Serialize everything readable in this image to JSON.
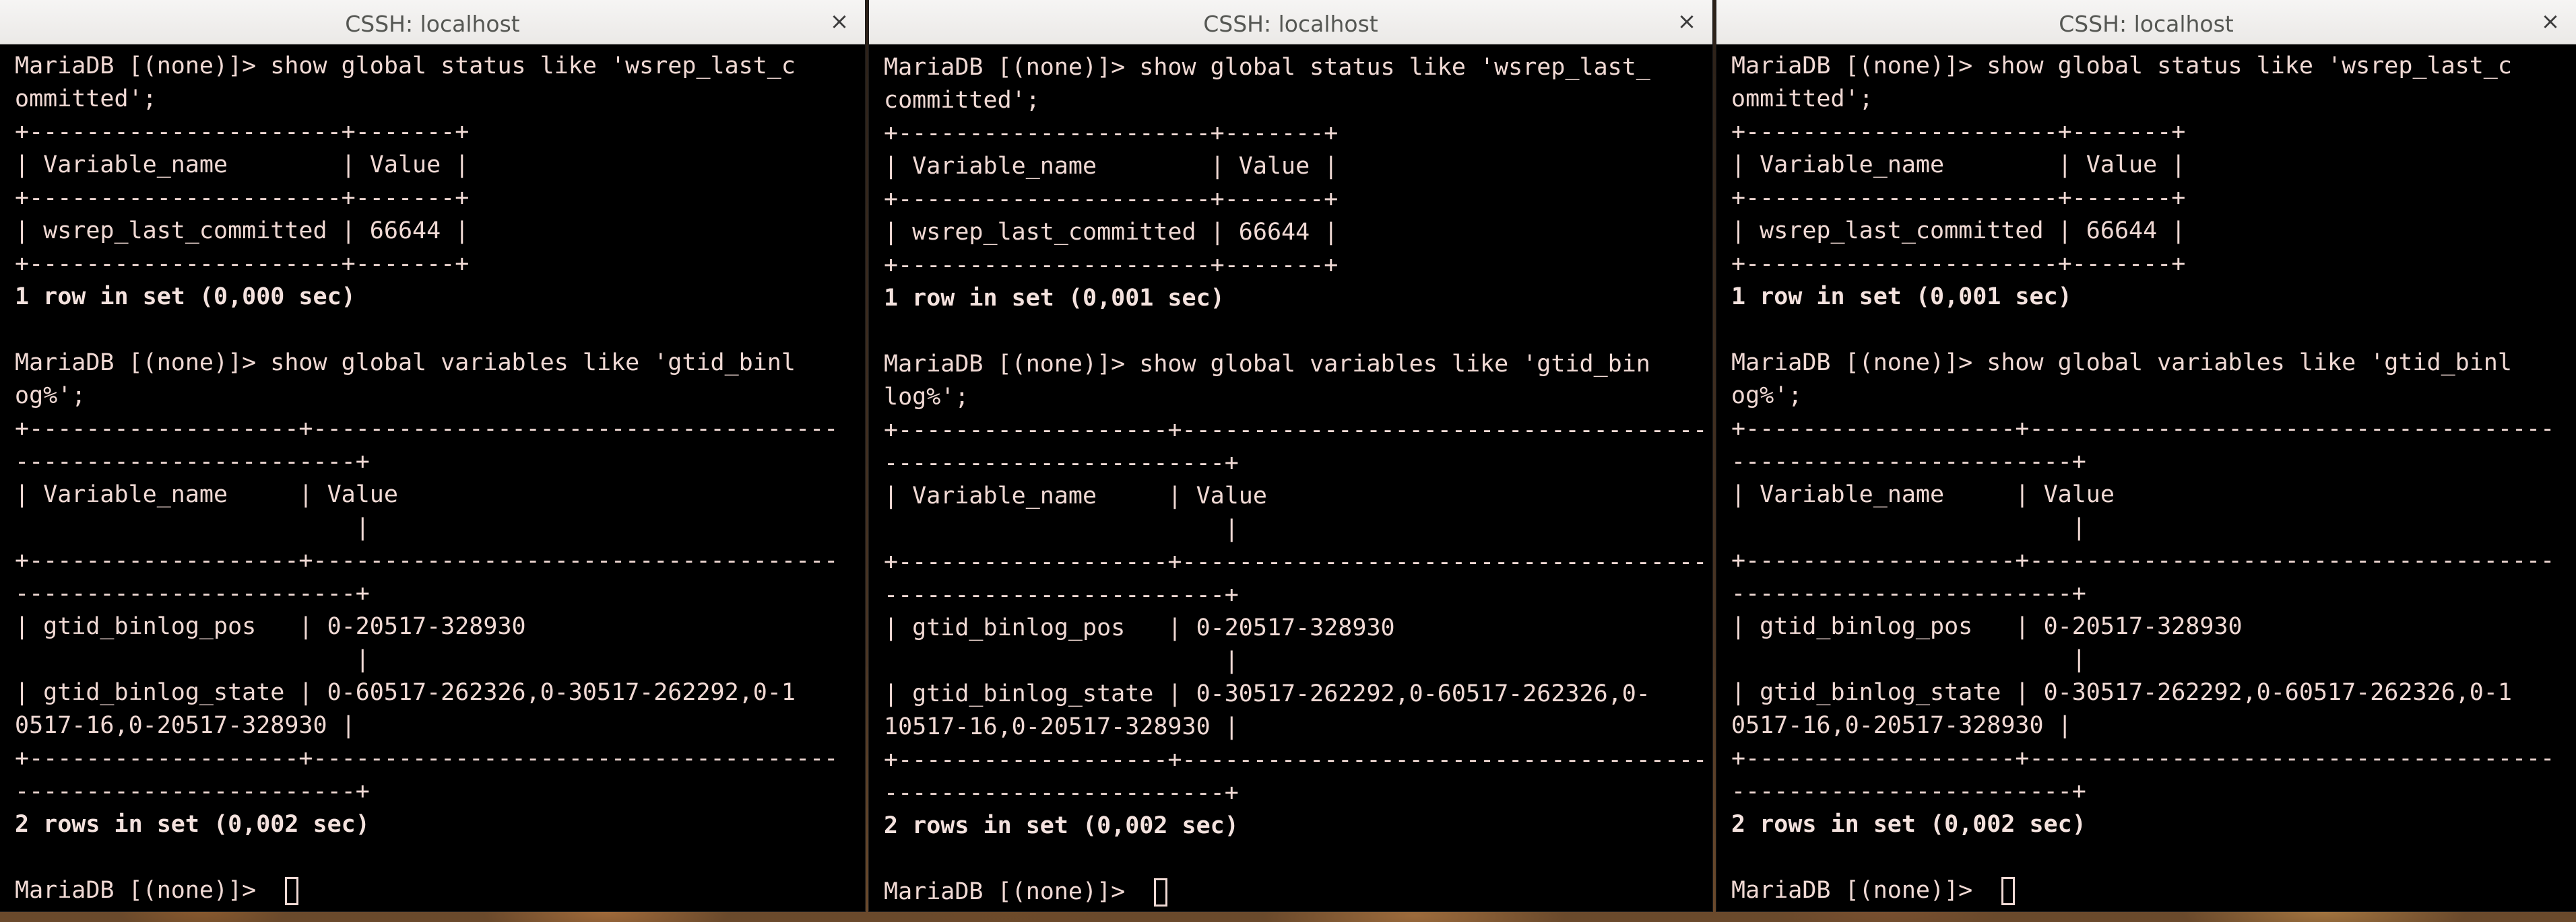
{
  "windows": [
    {
      "title": "CSSH: localhost",
      "close_label": "×",
      "lines": [
        {
          "text": "MariaDB [(none)]> show global status like 'wsrep_last_c",
          "bold": false
        },
        {
          "text": "ommitted';",
          "bold": false
        },
        {
          "text": "+----------------------+-------+",
          "bold": false
        },
        {
          "text": "| Variable_name        | Value |",
          "bold": false
        },
        {
          "text": "+----------------------+-------+",
          "bold": false
        },
        {
          "text": "| wsrep_last_committed | 66644 |",
          "bold": false
        },
        {
          "text": "+----------------------+-------+",
          "bold": false
        },
        {
          "text": "1 row in set (0,000 sec)",
          "bold": true
        },
        {
          "text": "",
          "bold": false
        },
        {
          "text": "MariaDB [(none)]> show global variables like 'gtid_binl",
          "bold": false
        },
        {
          "text": "og%';",
          "bold": false
        },
        {
          "text": "+-------------------+-------------------------------------",
          "bold": false
        },
        {
          "text": "------------------------+",
          "bold": false
        },
        {
          "text": "| Variable_name     | Value",
          "bold": false
        },
        {
          "text": "                        |",
          "bold": false
        },
        {
          "text": "+-------------------+-------------------------------------",
          "bold": false
        },
        {
          "text": "------------------------+",
          "bold": false
        },
        {
          "text": "| gtid_binlog_pos   | 0-20517-328930",
          "bold": false
        },
        {
          "text": "                        |",
          "bold": false
        },
        {
          "text": "| gtid_binlog_state | 0-60517-262326,0-30517-262292,0-1",
          "bold": false
        },
        {
          "text": "0517-16,0-20517-328930 |",
          "bold": false
        },
        {
          "text": "+-------------------+-------------------------------------",
          "bold": false
        },
        {
          "text": "------------------------+",
          "bold": false
        },
        {
          "text": "2 rows in set (0,002 sec)",
          "bold": true
        },
        {
          "text": "",
          "bold": false
        }
      ],
      "prompt": "MariaDB [(none)]> "
    },
    {
      "title": "CSSH: localhost",
      "close_label": "×",
      "lines": [
        {
          "text": "MariaDB [(none)]> show global status like 'wsrep_last_",
          "bold": false
        },
        {
          "text": "committed';",
          "bold": false
        },
        {
          "text": "+----------------------+-------+",
          "bold": false
        },
        {
          "text": "| Variable_name        | Value |",
          "bold": false
        },
        {
          "text": "+----------------------+-------+",
          "bold": false
        },
        {
          "text": "| wsrep_last_committed | 66644 |",
          "bold": false
        },
        {
          "text": "+----------------------+-------+",
          "bold": false
        },
        {
          "text": "1 row in set (0,001 sec)",
          "bold": true
        },
        {
          "text": "",
          "bold": false
        },
        {
          "text": "MariaDB [(none)]> show global variables like 'gtid_bin",
          "bold": false
        },
        {
          "text": "log%';",
          "bold": false
        },
        {
          "text": "+-------------------+-------------------------------------",
          "bold": false
        },
        {
          "text": "------------------------+",
          "bold": false
        },
        {
          "text": "| Variable_name     | Value",
          "bold": false
        },
        {
          "text": "                        |",
          "bold": false
        },
        {
          "text": "+-------------------+-------------------------------------",
          "bold": false
        },
        {
          "text": "------------------------+",
          "bold": false
        },
        {
          "text": "| gtid_binlog_pos   | 0-20517-328930",
          "bold": false
        },
        {
          "text": "                        |",
          "bold": false
        },
        {
          "text": "| gtid_binlog_state | 0-30517-262292,0-60517-262326,0-",
          "bold": false
        },
        {
          "text": "10517-16,0-20517-328930 |",
          "bold": false
        },
        {
          "text": "+-------------------+-------------------------------------",
          "bold": false
        },
        {
          "text": "------------------------+",
          "bold": false
        },
        {
          "text": "2 rows in set (0,002 sec)",
          "bold": true
        },
        {
          "text": "",
          "bold": false
        }
      ],
      "prompt": "MariaDB [(none)]> "
    },
    {
      "title": "CSSH: localhost",
      "close_label": "×",
      "lines": [
        {
          "text": "MariaDB [(none)]> show global status like 'wsrep_last_c",
          "bold": false
        },
        {
          "text": "ommitted';",
          "bold": false
        },
        {
          "text": "+----------------------+-------+",
          "bold": false
        },
        {
          "text": "| Variable_name        | Value |",
          "bold": false
        },
        {
          "text": "+----------------------+-------+",
          "bold": false
        },
        {
          "text": "| wsrep_last_committed | 66644 |",
          "bold": false
        },
        {
          "text": "+----------------------+-------+",
          "bold": false
        },
        {
          "text": "1 row in set (0,001 sec)",
          "bold": true
        },
        {
          "text": "",
          "bold": false
        },
        {
          "text": "MariaDB [(none)]> show global variables like 'gtid_binl",
          "bold": false
        },
        {
          "text": "og%';",
          "bold": false
        },
        {
          "text": "+-------------------+-------------------------------------",
          "bold": false
        },
        {
          "text": "------------------------+",
          "bold": false
        },
        {
          "text": "| Variable_name     | Value",
          "bold": false
        },
        {
          "text": "                        |",
          "bold": false
        },
        {
          "text": "+-------------------+-------------------------------------",
          "bold": false
        },
        {
          "text": "------------------------+",
          "bold": false
        },
        {
          "text": "| gtid_binlog_pos   | 0-20517-328930",
          "bold": false
        },
        {
          "text": "                        |",
          "bold": false
        },
        {
          "text": "| gtid_binlog_state | 0-30517-262292,0-60517-262326,0-1",
          "bold": false
        },
        {
          "text": "0517-16,0-20517-328930 |",
          "bold": false
        },
        {
          "text": "+-------------------+-------------------------------------",
          "bold": false
        },
        {
          "text": "------------------------+",
          "bold": false
        },
        {
          "text": "2 rows in set (0,002 sec)",
          "bold": true
        },
        {
          "text": "",
          "bold": false
        }
      ],
      "prompt": "MariaDB [(none)]> "
    }
  ],
  "icons": {
    "close": "close-icon",
    "cursor": "terminal-cursor"
  },
  "colors": {
    "terminal_bg": "#000000",
    "terminal_fg": "#f0d9d4",
    "titlebar_bg": "#f6f5f4",
    "titlebar_fg": "#555753"
  }
}
